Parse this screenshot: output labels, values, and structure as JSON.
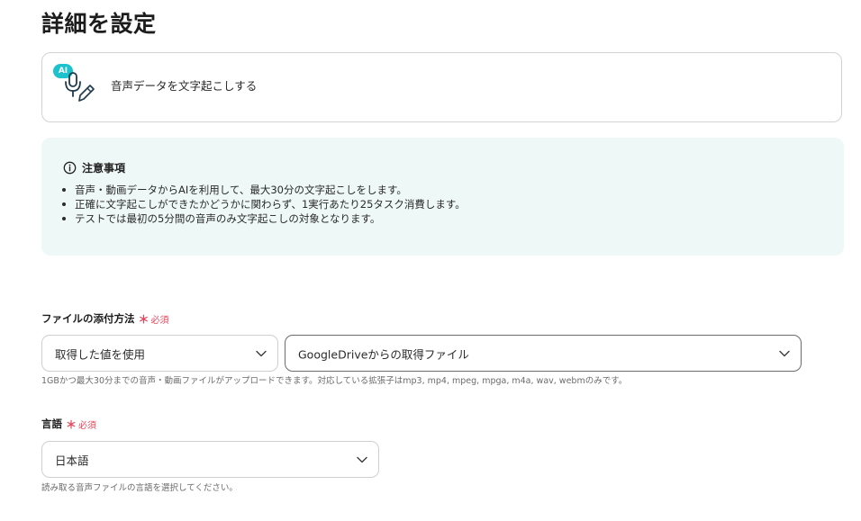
{
  "page": {
    "title": "詳細を設定"
  },
  "action": {
    "badge": "AI",
    "icon": "mic-pen-icon",
    "label": "音声データを文字起こしする"
  },
  "notice": {
    "icon": "info-icon",
    "title": "注意事項",
    "items": [
      "音声・動画データからAIを利用して、最大30分の文字起こしをします。",
      "正確に文字起こしができたかどうかに関わらず、1実行あたり25タスク消費します。",
      "テストでは最初の5分間の音声のみ文字起こしの対象となります。"
    ]
  },
  "file_attach": {
    "label": "ファイルの添付方法",
    "required_mark": "＊",
    "required_text": "必須",
    "method_select": {
      "value": "取得した値を使用"
    },
    "source_select": {
      "value": "GoogleDriveからの取得ファイル"
    },
    "help": "1GBかつ最大30分までの音声・動画ファイルがアップロードできます。対応している拡張子はmp3, mp4, mpeg, mpga, m4a, wav, webmのみです。"
  },
  "language": {
    "label": "言語",
    "required_mark": "＊",
    "required_text": "必須",
    "select": {
      "value": "日本語"
    },
    "help": "読み取る音声ファイルの言語を選択してください。"
  },
  "colors": {
    "accent": "#1cc2cc",
    "required": "#e8455a",
    "notice_bg": "#eef8f7"
  }
}
